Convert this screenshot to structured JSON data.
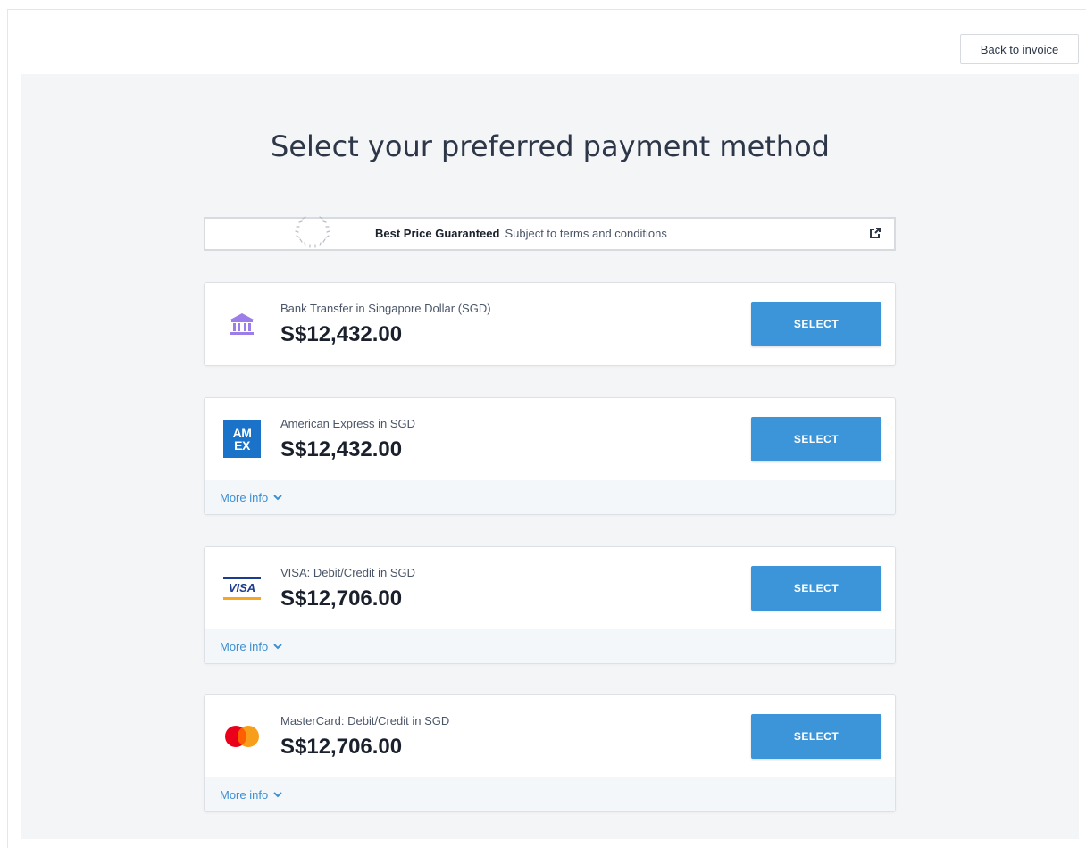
{
  "header": {
    "back_label": "Back to invoice"
  },
  "main": {
    "title": "Select your preferred payment method",
    "guarantee": {
      "title": "Best Price Guaranteed",
      "subtitle": "Subject to terms and conditions"
    },
    "methods": [
      {
        "icon": "bank-icon",
        "name": "Bank Transfer in Singapore Dollar (SGD)",
        "amount": "S$12,432.00",
        "button": "SELECT",
        "more_info": null
      },
      {
        "icon": "amex-icon",
        "name": "American Express in SGD",
        "amount": "S$12,432.00",
        "button": "SELECT",
        "more_info": "More info"
      },
      {
        "icon": "visa-icon",
        "name": "VISA: Debit/Credit in SGD",
        "amount": "S$12,706.00",
        "button": "SELECT",
        "more_info": "More info"
      },
      {
        "icon": "mastercard-icon",
        "name": "MasterCard: Debit/Credit in SGD",
        "amount": "S$12,706.00",
        "button": "SELECT",
        "more_info": "More info"
      }
    ]
  },
  "logos": {
    "amex_line1": "AM",
    "amex_line2": "EX",
    "visa_text": "VISA"
  },
  "colors": {
    "accent": "#3d95d9",
    "link": "#3d8fd3",
    "panel_bg": "#f4f5f6",
    "bank_icon": "#9b7ee8",
    "amex_blue": "#1a72c9",
    "mastercard_red": "#eb001b",
    "mastercard_orange": "#f79e1b"
  }
}
